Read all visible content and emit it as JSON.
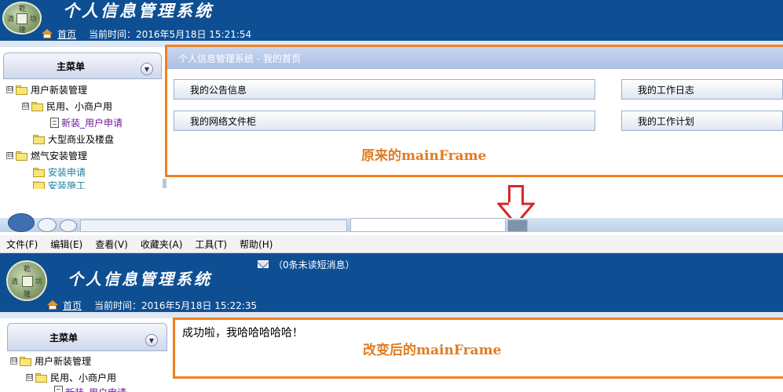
{
  "top": {
    "banner": {
      "title": "个人信息管理系统",
      "home_link": "首页",
      "time_label": "当前时间：2016年5月18日 15:21:54",
      "logo_chars": [
        "乾",
        "清",
        "坊",
        "隆"
      ]
    },
    "sidebar": {
      "header": "主菜单",
      "tree": [
        {
          "label": "用户新装管理",
          "expander": "⊟"
        },
        {
          "label": "民用、小商户用",
          "expander": "⊟"
        },
        {
          "label": "新装_用户申请"
        },
        {
          "label": "大型商业及楼盘"
        },
        {
          "label": "燃气安装管理",
          "expander": "⊟"
        },
        {
          "label": "安装申请"
        },
        {
          "label": "安装施工"
        }
      ]
    },
    "main": {
      "header": "个人信息管理系统 - 我的首页",
      "buttons": [
        "我的公告信息",
        "我的工作日志",
        "我的网络文件柜",
        "我的工作计划"
      ],
      "caption": "原来的mainFrame"
    }
  },
  "bottom": {
    "browser": {
      "menu": [
        "文件(F)",
        "编辑(E)",
        "查看(V)",
        "收藏夹(A)",
        "工具(T)",
        "帮助(H)"
      ],
      "unread": "（0条未读短消息）"
    },
    "banner": {
      "title": "个人信息管理系统",
      "home_link": "首页",
      "time_label": "当前时间：2016年5月18日 15:22:35"
    },
    "sidebar": {
      "header": "主菜单",
      "tree": [
        {
          "label": "用户新装管理",
          "expander": "⊟"
        },
        {
          "label": "民用、小商户用",
          "expander": "⊟"
        },
        {
          "label": "新装_用户申请"
        }
      ]
    },
    "main": {
      "message": "成功啦，我哈哈哈哈哈！",
      "caption": "改变后的mainFrame"
    }
  },
  "colors": {
    "banner": "#0e4f93",
    "frame_border": "#f08020",
    "caption": "#e07b20",
    "arrow": "#d62828",
    "tree_link": "#6a1b9a",
    "tree_teal": "#1a7fa0"
  },
  "icons": [
    "home-icon",
    "folder-icon",
    "document-icon",
    "chevron-down-icon",
    "mail-icon",
    "down-arrow-icon"
  ]
}
